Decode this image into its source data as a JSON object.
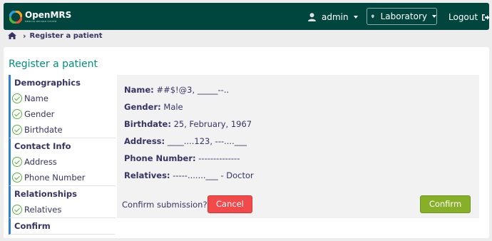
{
  "header": {
    "logo_text": "OpenMRS",
    "logo_subtext": "MEDICAL RECORD SYSTEM",
    "user": "admin",
    "location": "Laboratory",
    "logout": "Logout"
  },
  "breadcrumb": {
    "current": "Register a patient"
  },
  "page_title": "Register a patient",
  "sidebar": {
    "sections": [
      {
        "title": "Demographics",
        "fields": [
          "Name",
          "Gender",
          "Birthdate"
        ]
      },
      {
        "title": "Contact Info",
        "fields": [
          "Address",
          "Phone Number"
        ]
      },
      {
        "title": "Relationships",
        "fields": [
          "Relatives"
        ]
      },
      {
        "title": "Confirm",
        "fields": []
      }
    ]
  },
  "summary": {
    "name_label": "Name:",
    "name_value": "##$!@3, _____--..",
    "gender_label": "Gender:",
    "gender_value": "Male",
    "birthdate_label": "Birthdate:",
    "birthdate_value": "25, February, 1967",
    "address_label": "Address:",
    "address_value": "____....123, ---....___",
    "phone_label": "Phone Number:",
    "phone_value": "--------------",
    "relatives_label": "Relatives:",
    "relatives_value": "-----.......___ - Doctor"
  },
  "confirm": {
    "question": "Confirm submission?",
    "cancel_label": "Cancel",
    "confirm_label": "Confirm"
  },
  "colors": {
    "header_bg": "#00463f",
    "title_teal": "#00907a",
    "section_accent": "#2f7ed8",
    "check_green": "#5bb33a",
    "cancel_red": "#f24a4a",
    "confirm_green": "#88af28"
  }
}
